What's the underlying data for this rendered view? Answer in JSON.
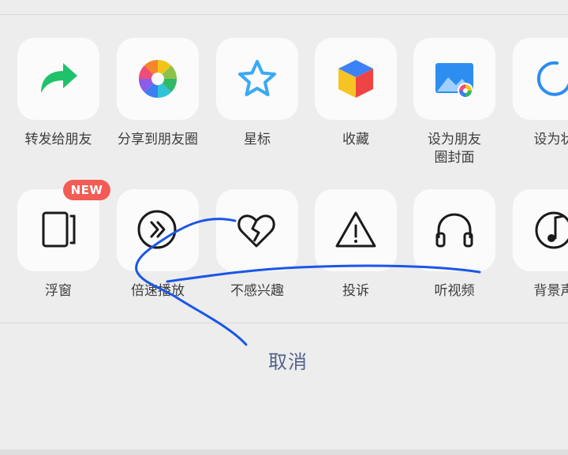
{
  "share_row": {
    "items": [
      {
        "label": "转发给朋友",
        "icon": "forward-arrow-icon",
        "color": "#1fc16b"
      },
      {
        "label": "分享到朋友圈",
        "icon": "moments-aperture-icon"
      },
      {
        "label": "星标",
        "icon": "star-icon",
        "color": "#3aa9f5"
      },
      {
        "label": "收藏",
        "icon": "favorites-cube-icon"
      },
      {
        "label": "设为朋友\n圈封面",
        "icon": "moments-cover-image-icon",
        "color": "#2d8df0"
      },
      {
        "label": "设为状",
        "icon": "status-circle-icon",
        "color": "#2d8df0"
      }
    ]
  },
  "action_row": {
    "items": [
      {
        "label": "浮窗",
        "icon": "floating-window-icon",
        "badge": "NEW"
      },
      {
        "label": "倍速播放",
        "icon": "playback-speed-icon"
      },
      {
        "label": "不感兴趣",
        "icon": "broken-heart-icon"
      },
      {
        "label": "投诉",
        "icon": "warning-triangle-icon"
      },
      {
        "label": "听视频",
        "icon": "headphones-icon"
      },
      {
        "label": "背景声",
        "icon": "music-note-icon"
      }
    ]
  },
  "cancel_label": "取消",
  "colors": {
    "background": "#ededed",
    "tile": "#fbfbfb",
    "badge": "#f25c54",
    "cancel_text": "#55628f",
    "annotation_stroke": "#1a56e8"
  }
}
